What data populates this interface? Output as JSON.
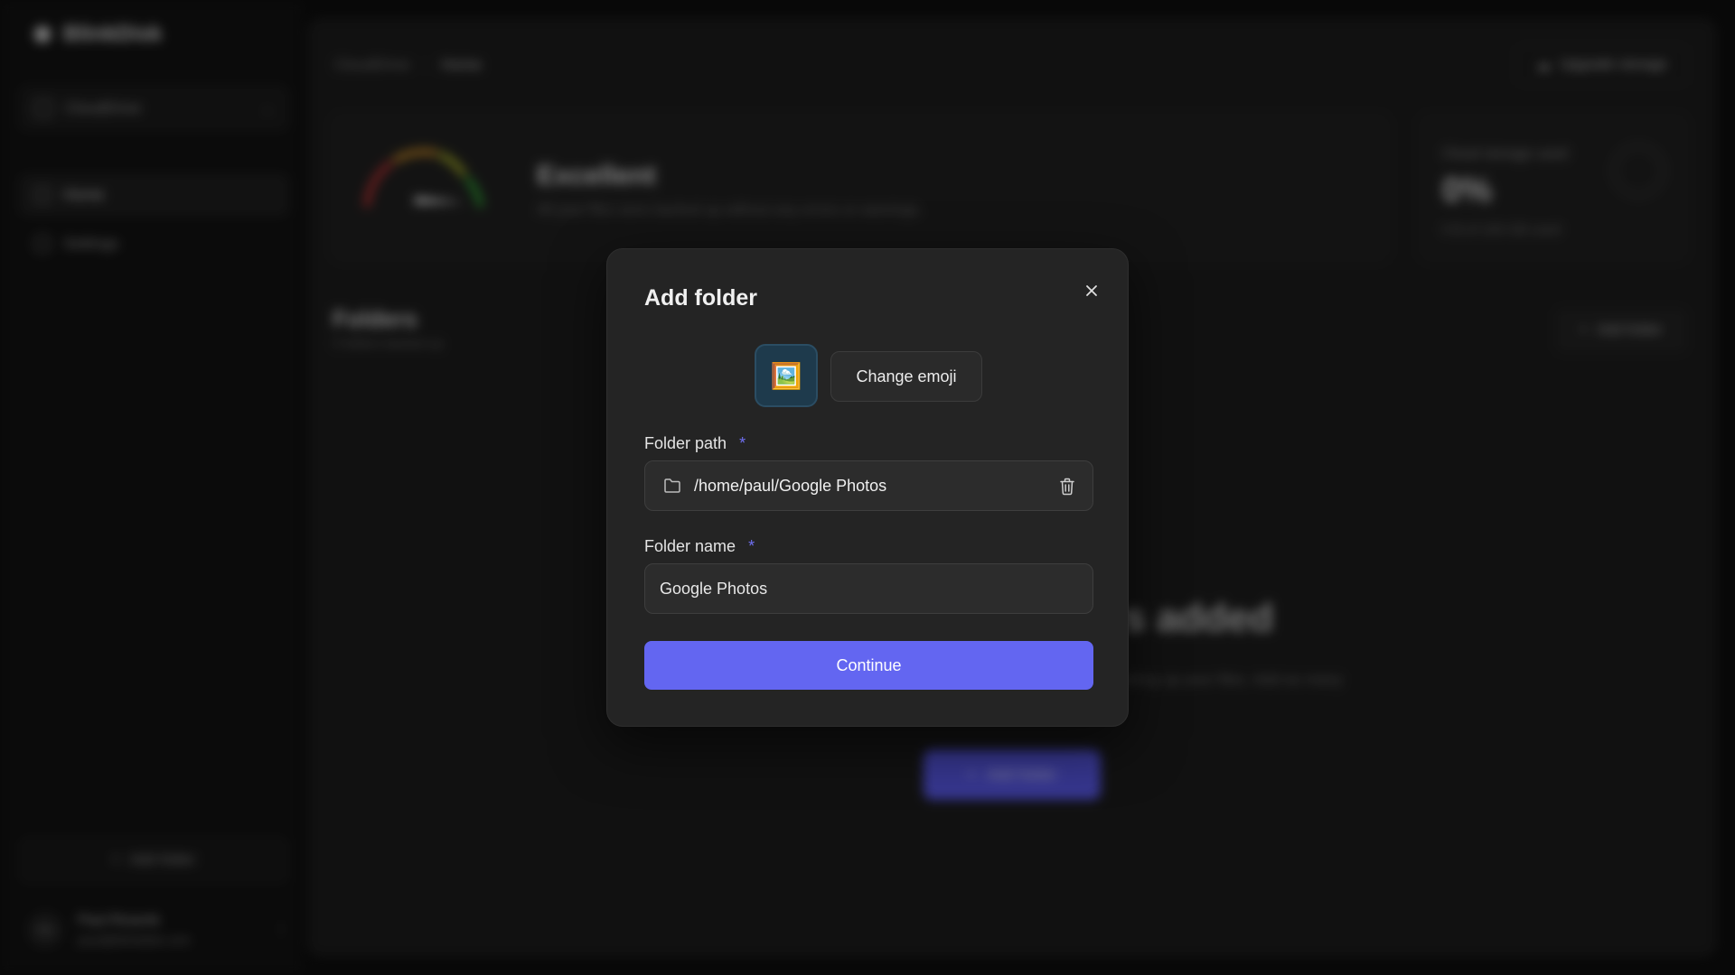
{
  "app": {
    "brand": "BlinkDisk",
    "workspace": "CloudDrive"
  },
  "sidebar": {
    "items": [
      {
        "label": "Home",
        "icon": "home-icon",
        "active": true
      },
      {
        "label": "Settings",
        "icon": "settings-icon",
        "active": false
      }
    ],
    "add_folder_label": "Add folder",
    "user": {
      "initials": "PA",
      "name": "Paul Rosenk",
      "email": "paul@blinkdisk.com"
    }
  },
  "header": {
    "breadcrumb": [
      "CloudDrive",
      "Home"
    ],
    "upgrade_label": "Upgrade storage"
  },
  "status": {
    "title": "Excellent",
    "subtitle": "All your files were backed up without any errors or warnings."
  },
  "storage": {
    "label": "Cloud storage used",
    "percent": "0%",
    "used": "0 B of 100 GB used"
  },
  "folders": {
    "title": "Folders",
    "subtitle": "0 folders backed up",
    "add_label": "Add folder",
    "empty_title": "No folders added",
    "empty_desc": "Add a folder to start backing up your files. Add as many folders as you like.",
    "empty_button": "Add folder"
  },
  "modal": {
    "title": "Add folder",
    "close_icon": "close-icon",
    "emoji": "🖼️",
    "change_emoji_label": "Change emoji",
    "path_label": "Folder path",
    "required_mark": "*",
    "path_value": "/home/paul/Google Photos",
    "name_label": "Folder name",
    "name_value": "Google Photos",
    "continue_label": "Continue",
    "colors": {
      "primary": "#6366f1",
      "emoji_bg": "#1e3a4c",
      "required": "#6f6ff0"
    }
  }
}
